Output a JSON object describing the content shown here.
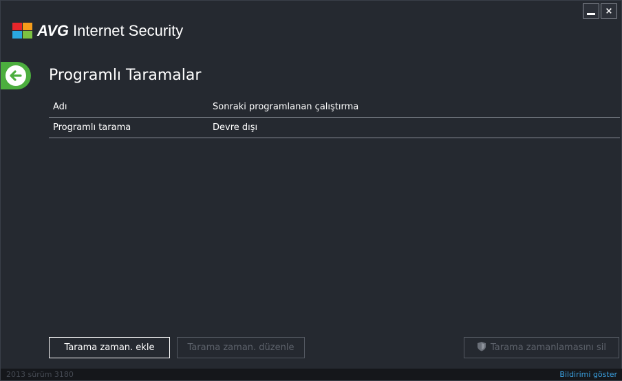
{
  "app": {
    "brand": "AVG",
    "product": "Internet Security",
    "window_controls": {
      "minimize": "_",
      "close": "×"
    }
  },
  "page": {
    "title": "Programlı Taramalar"
  },
  "table": {
    "columns": [
      "Adı",
      "Sonraki programlanan çalıştırma"
    ],
    "rows": [
      {
        "name": "Programlı tarama",
        "next_run": "Devre dışı"
      }
    ]
  },
  "buttons": {
    "add": "Tarama zaman. ekle",
    "edit": "Tarama zaman. düzenle",
    "delete": "Tarama zamanlamasını sil"
  },
  "status_bar": {
    "version": "2013  sürüm 3180",
    "notification_link": "Bildirimi göster"
  },
  "colors": {
    "background": "#252930",
    "back_button": "#4cae3e",
    "link": "#3aa0e0",
    "disabled_text": "#5d626b"
  },
  "icons": [
    "avg-logo",
    "back-arrow-icon",
    "shield-icon",
    "minimize-icon",
    "close-icon"
  ]
}
